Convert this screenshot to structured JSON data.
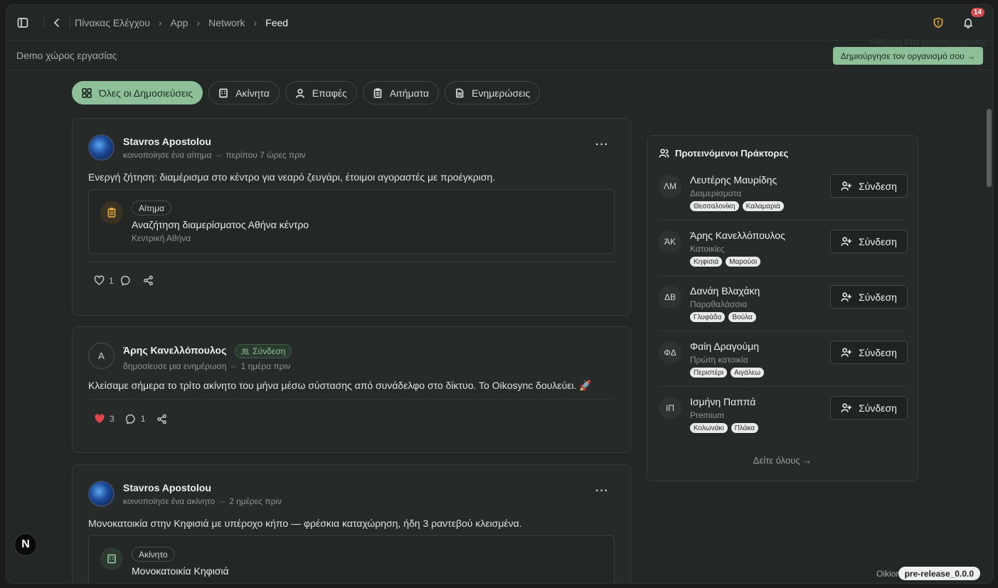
{
  "header": {
    "breadcrumbs": [
      "Πίνακας Ελέγχου",
      "App",
      "Network",
      "Feed"
    ],
    "notification_count": "14"
  },
  "workspace": {
    "name": "Demo χώρος εργασίας",
    "ghost_text": "Ρύθμιση PIN κρυπτογράφησης",
    "create_org_label": "Δημιούργησε τον οργανισμό σου →"
  },
  "filters": [
    {
      "label": "Όλες οι Δημοσιεύσεις",
      "icon": "grid-icon",
      "active": true
    },
    {
      "label": "Ακίνητα",
      "icon": "building-icon"
    },
    {
      "label": "Επαφές",
      "icon": "user-icon"
    },
    {
      "label": "Αιτήματα",
      "icon": "clipboard-icon"
    },
    {
      "label": "Ενημερώσεις",
      "icon": "document-icon"
    }
  ],
  "posts": [
    {
      "author": "Stavros Apostolou",
      "action": "κοινοποίησε ένα αίτημα",
      "time": "περίπου 7 ώρες πριν",
      "text": "Ενεργή ζήτηση: διαμέρισμα στο κέντρο για νεαρό ζευγάρι, έτοιμοι αγοραστές με προέγκριση.",
      "attachment": {
        "tag": "Αίτημα",
        "title": "Αναζήτηση διαμερίσματος Αθήνα κέντρο",
        "subtitle": "Κεντρική Αθήνα"
      },
      "likes": "1"
    },
    {
      "author": "Άρης Κανελλόπουλος",
      "initial": "A",
      "connection_label": "Σύνδεση",
      "action": "δημοσίευσε μια ενημέρωση",
      "time": "1 ημέρα πριν",
      "text": "Κλείσαμε σήμερα το τρίτο ακίνητο του μήνα μέσω σύστασης από συνάδελφο στο δίκτυο. Το Oikosync δουλεύει. 🚀",
      "likes": "3",
      "comments": "1"
    },
    {
      "author": "Stavros Apostolou",
      "action": "κοινοποίησε ένα ακίνητο",
      "time": "2 ημέρες πριν",
      "text": "Μονοκατοικία στην Κηφισιά με υπέροχο κήπο — φρέσκια καταχώρηση, ήδη 3 ραντεβού κλεισμένα.",
      "attachment": {
        "tag": "Ακίνητο",
        "title": "Μονοκατοικία Κηφισιά"
      }
    }
  ],
  "suggestions": {
    "title": "Προτεινόμενοι Πράκτορες",
    "connect_label": "Σύνδεση",
    "see_all": "Δείτε όλους →",
    "agents": [
      {
        "initials": "ΛΜ",
        "name": "Λευτέρης Μαυρίδης",
        "role": "Διαμερίσματα",
        "tags": [
          "Θεσσαλονίκη",
          "Καλαμαριά"
        ]
      },
      {
        "initials": "ΆΚ",
        "name": "Άρης Κανελλόπουλος",
        "role": "Κατοικίες",
        "tags": [
          "Κηφισιά",
          "Μαρούσι"
        ]
      },
      {
        "initials": "ΔΒ",
        "name": "Δανάη Βλαχάκη",
        "role": "Παραθαλάσσια",
        "tags": [
          "Γλυφάδα",
          "Βούλα"
        ]
      },
      {
        "initials": "ΦΔ",
        "name": "Φαίη Δραγούμη",
        "role": "Πρώτη κατοικία",
        "tags": [
          "Περιστέρι",
          "Αιγάλεω"
        ]
      },
      {
        "initials": "ΙΠ",
        "name": "Ισμήνη Παππά",
        "role": "Premium",
        "tags": [
          "Κολωνάκι",
          "Πλάκα"
        ]
      }
    ]
  },
  "footer": {
    "brand": "Oikion",
    "release": "pre-release_0.0.0",
    "logo_letter": "N"
  },
  "colors": {
    "accent": "#8dbf99",
    "heart": "#e0474c",
    "warning": "#d9a441"
  }
}
